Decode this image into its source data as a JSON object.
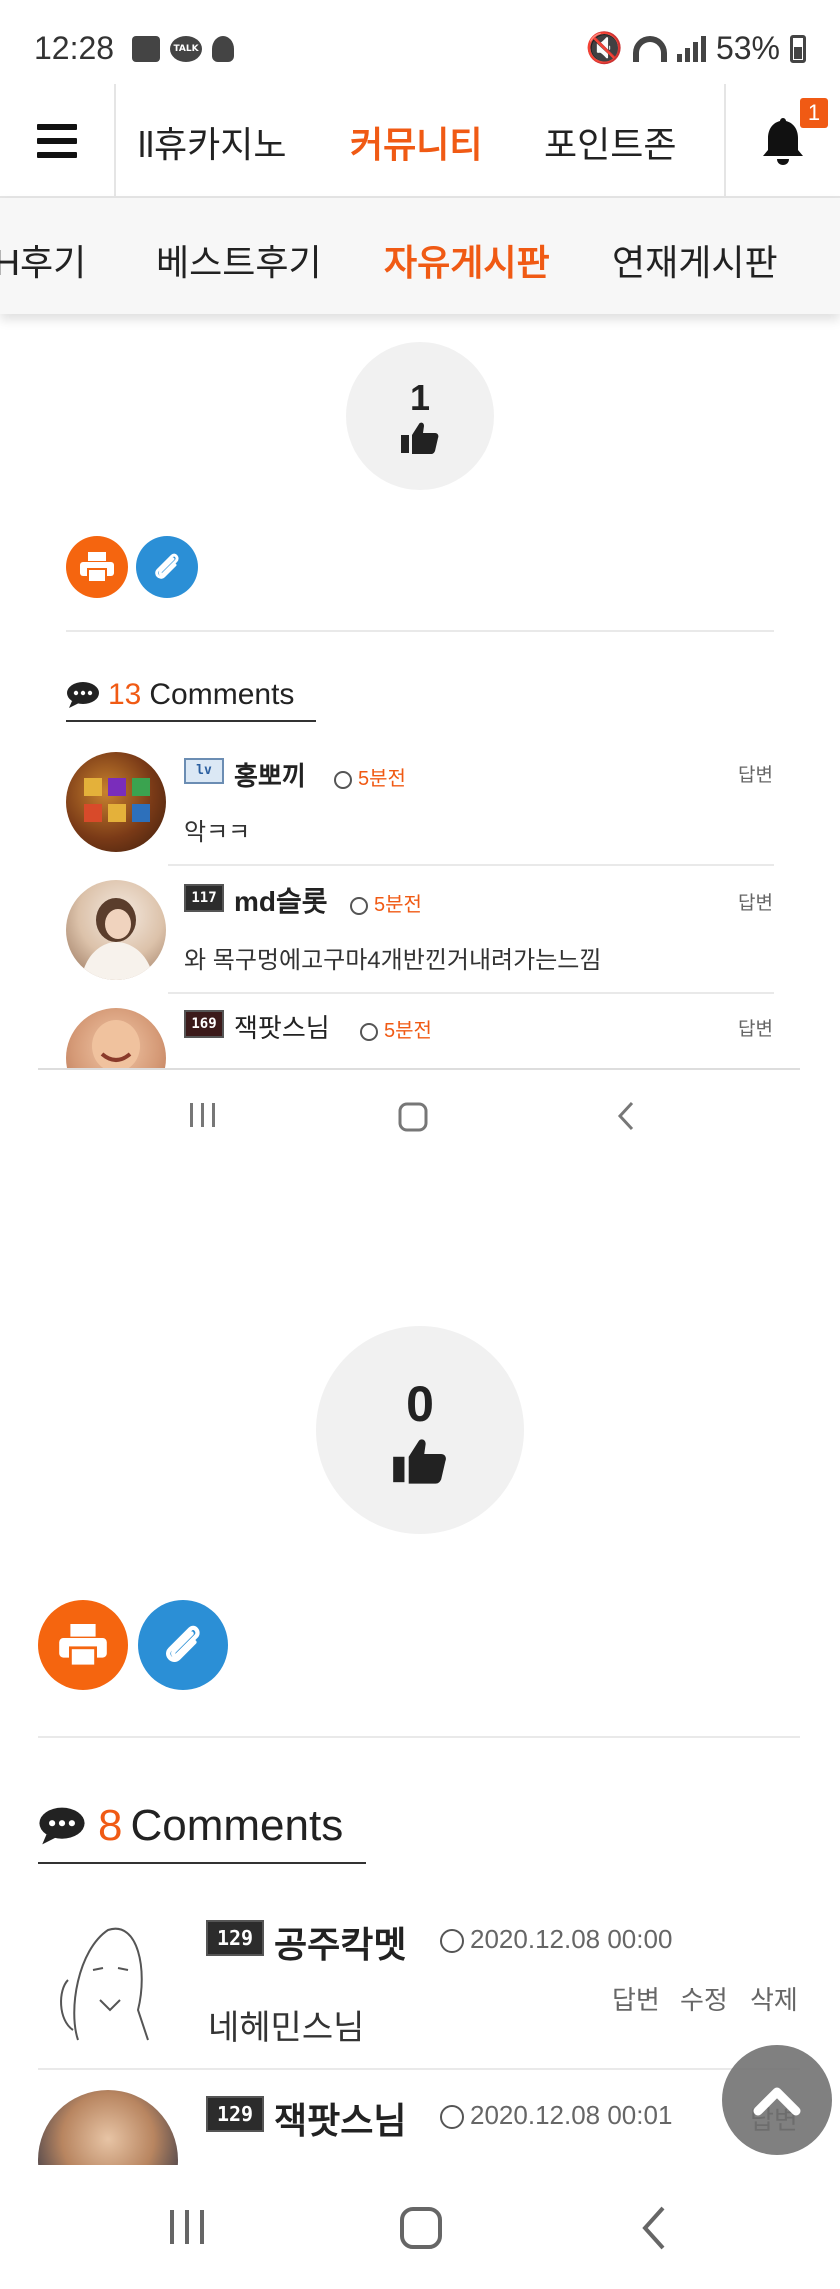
{
  "status_bar": {
    "time": "12:28",
    "talk_label": "TALK",
    "battery": "53%"
  },
  "top_nav": {
    "tabs": [
      "ll휴카지노",
      "커뮤니티",
      "포인트존"
    ],
    "active_tab": "커뮤니티",
    "notification_count": "1"
  },
  "sub_nav": {
    "tabs": [
      "H후기",
      "베스트후기",
      "자유게시판",
      "연재게시판"
    ],
    "active_tab": "자유게시판"
  },
  "post_top": {
    "likes": "1",
    "comments_count": "13",
    "comments_label": "Comments",
    "comments": [
      {
        "level": "lv",
        "name": "홍뽀끼",
        "time": "5분전",
        "text": "악ㅋㅋ",
        "reply": "답변"
      },
      {
        "level": "117",
        "name": "md슬롯",
        "time": "5분전",
        "text": "와 목구멍에고구마4개반낀거내려가는느낌",
        "reply": "답변"
      },
      {
        "level": "169",
        "name": "잭팟스님",
        "time": "5분전",
        "text": "",
        "reply": "답변"
      }
    ]
  },
  "post_bottom": {
    "likes": "0",
    "comments_count": "8",
    "comments_label": "Comments",
    "comments": [
      {
        "level": "129",
        "name": "공주칵멧",
        "time": "2020.12.08 00:00",
        "text": "네헤민스님",
        "reply": "답변",
        "edit": "수정",
        "delete": "삭제"
      },
      {
        "level": "129",
        "name": "잭팟스님",
        "time": "2020.12.08 00:01",
        "text": "",
        "reply": "답변"
      }
    ]
  },
  "colors": {
    "accent": "#f05a14",
    "print_button": "#f5650f",
    "attach_button": "#2b8fd6"
  },
  "icons": [
    "hamburger-icon",
    "bell-icon",
    "thumbs-up-icon",
    "print-icon",
    "paperclip-icon",
    "comment-bubble-icon",
    "clock-icon",
    "chevron-up-icon",
    "recents-icon",
    "home-icon",
    "back-icon"
  ]
}
